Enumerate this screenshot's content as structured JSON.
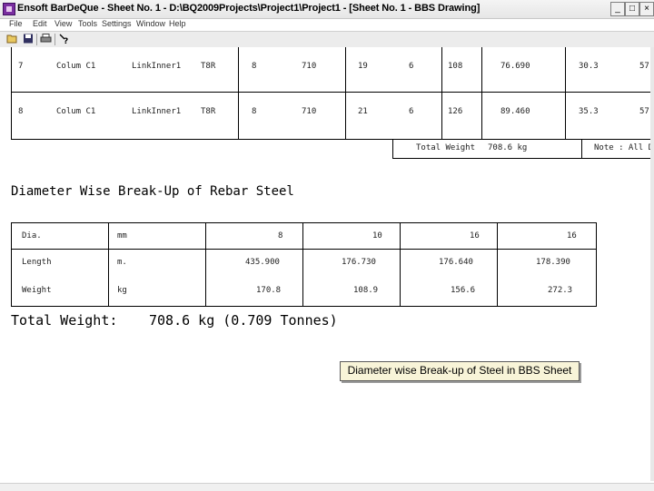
{
  "window": {
    "title": "Ensoft BarDeQue - Sheet No.  1 - D:\\BQ2009Projects\\Project1\\Project1 - [Sheet No. 1 - BBS Drawing]",
    "controls": [
      "_",
      "□",
      "×"
    ]
  },
  "menu": [
    "File",
    "Edit",
    "View",
    "Tools",
    "Settings",
    "Window",
    "Help"
  ],
  "toolbar": [
    "open-icon",
    "save-icon",
    "print-icon",
    "help-icon"
  ],
  "bbs_rows": [
    [
      "7",
      "Colum C1",
      "LinkInner1",
      "T8R",
      "8",
      "710",
      "19",
      "6",
      "108",
      "76.690",
      "30.3",
      "57"
    ],
    [
      "8",
      "Colum C1",
      "LinkInner1",
      "T8R",
      "8",
      "710",
      "21",
      "6",
      "126",
      "89.460",
      "35.3",
      "57"
    ]
  ],
  "bbs_footer": {
    "total_weight_label": "Total Weight",
    "total_weight_value": "708.6 kg",
    "note": "Note : All Dime"
  },
  "breakup": {
    "heading": "Diameter Wise Break-Up of Rebar Steel",
    "rows": [
      [
        "Dia.",
        "mm",
        "8",
        "10",
        "16",
        "16"
      ],
      [
        "Length",
        "m.",
        "435.900",
        "176.730",
        "176.640",
        "178.390"
      ],
      [
        "Weight",
        "kg",
        "170.8",
        "108.9",
        "156.6",
        "272.3"
      ]
    ],
    "total_label": "Total Weight:",
    "total_value": "708.6 kg (0.709 Tonnes)"
  },
  "caption": "Diameter wise Break-up of Steel in BBS Sheet"
}
